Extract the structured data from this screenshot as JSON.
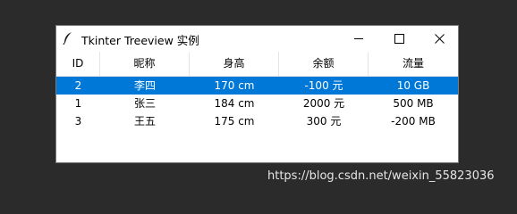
{
  "window": {
    "title": "Tkinter Treeview 实例",
    "icon": "feather-icon",
    "controls": [
      "minimize-icon",
      "maximize-icon",
      "close-icon"
    ]
  },
  "tree": {
    "columns": [
      "ID",
      "昵称",
      "身高",
      "余额",
      "流量"
    ],
    "rows": [
      {
        "id": "2",
        "nickname": "李四",
        "height": "170 cm",
        "balance": "-100 元",
        "traffic": "10 GB",
        "selected": true
      },
      {
        "id": "1",
        "nickname": "张三",
        "height": "184 cm",
        "balance": "2000 元",
        "traffic": "500 MB",
        "selected": false
      },
      {
        "id": "3",
        "nickname": "王五",
        "height": "175 cm",
        "balance": "300 元",
        "traffic": "-200 MB",
        "selected": false
      }
    ],
    "selection_color": "#0078d7"
  },
  "watermark": "https://blog.csdn.net/weixin_55823036"
}
